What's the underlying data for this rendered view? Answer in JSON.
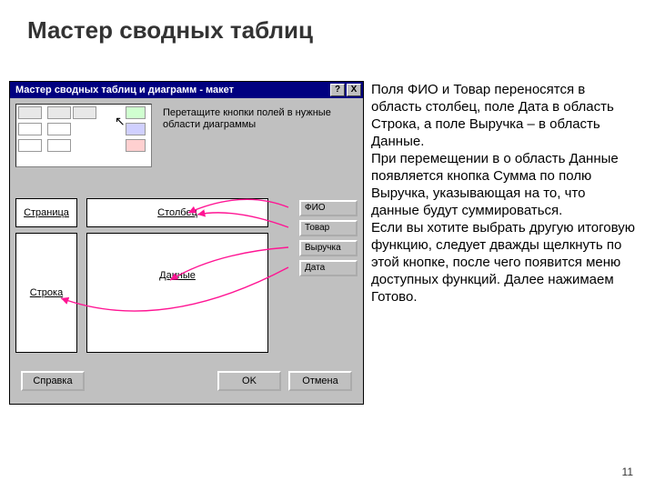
{
  "slide": {
    "title": "Мастер сводных таблиц",
    "pagenum": "11"
  },
  "dialog": {
    "title": "Мастер сводных таблиц и диаграмм - макет",
    "hint": "Перетащите кнопки полей в нужные области диаграммы",
    "zones": {
      "page": "Страница",
      "column": "Столбец",
      "row": "Строка",
      "data": "Данные"
    },
    "fields": {
      "fio": "ФИО",
      "tovar": "Товар",
      "vyruchka": "Выручка",
      "data": "Дата"
    },
    "buttons": {
      "help": "Справка",
      "ok": "OK",
      "cancel": "Отмена"
    },
    "titlebar": {
      "help": "?",
      "close": "X"
    }
  },
  "desc": {
    "text": "Поля ФИО и Товар переносятся в область столбец, поле Дата в область Строка, а поле Выручка – в область Данные.\nПри перемещении в о область Данные появляется кнопка Сумма по полю Выручка, указывающая на то, что данные будут суммироваться.\nЕсли вы хотите выбрать другую итоговую функцию, следует дважды щелкнуть по этой кнопке, после чего появится меню доступных функций. Далее нажимаем Готово."
  }
}
